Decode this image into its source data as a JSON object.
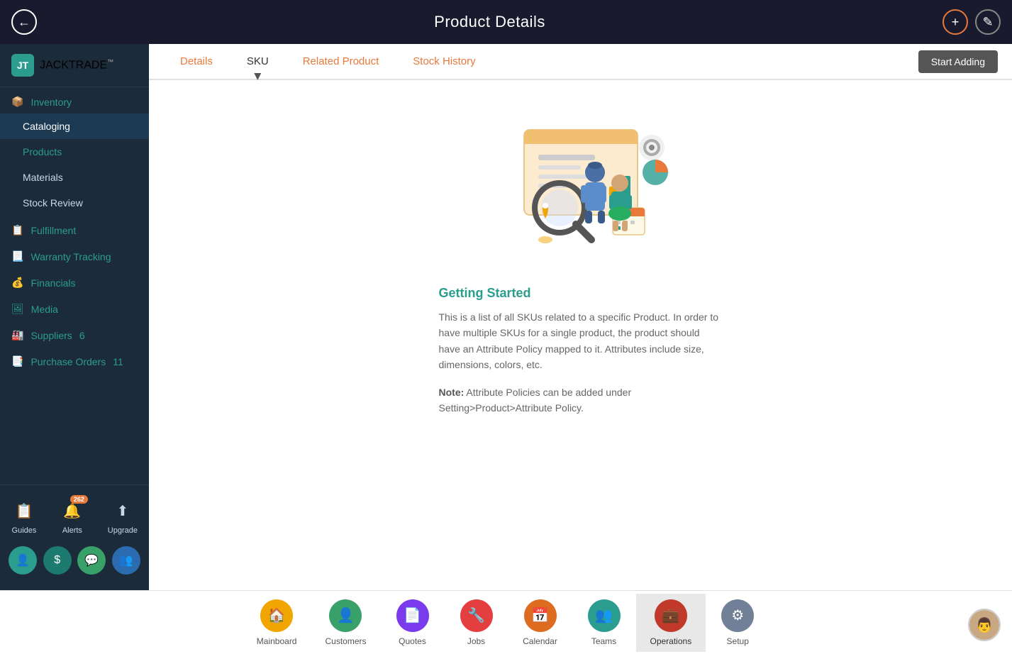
{
  "header": {
    "title": "Product Details",
    "back_label": "←",
    "add_icon": "+",
    "edit_icon": "✎"
  },
  "sidebar": {
    "logo_text": "JACKTRADE",
    "logo_tm": "™",
    "sections": [
      {
        "id": "inventory",
        "label": "Inventory",
        "active": true
      }
    ],
    "items": [
      {
        "id": "cataloging",
        "label": "Cataloging",
        "indent": true,
        "selected": true
      },
      {
        "id": "products",
        "label": "Products",
        "active": true
      },
      {
        "id": "materials",
        "label": "Materials",
        "indent": true
      },
      {
        "id": "stock-review",
        "label": "Stock Review",
        "indent": true
      },
      {
        "id": "fulfillment",
        "label": "Fulfillment"
      },
      {
        "id": "warranty-tracking",
        "label": "Warranty Tracking"
      },
      {
        "id": "financials",
        "label": "Financials"
      },
      {
        "id": "media",
        "label": "Media"
      },
      {
        "id": "suppliers",
        "label": "Suppliers",
        "badge": "6"
      },
      {
        "id": "purchase-orders",
        "label": "Purchase Orders",
        "badge": "11"
      }
    ],
    "bottom_items": [
      {
        "id": "guides",
        "label": "Guides",
        "icon": "📋"
      },
      {
        "id": "alerts",
        "label": "Alerts",
        "icon": "🔔",
        "badge": "262"
      },
      {
        "id": "upgrade",
        "label": "Upgrade",
        "icon": "⬆"
      }
    ],
    "user_icons": [
      {
        "id": "user",
        "icon": "👤",
        "color": "teal"
      },
      {
        "id": "dollar",
        "icon": "$",
        "color": "dark-teal"
      },
      {
        "id": "chat",
        "icon": "💬",
        "color": "green"
      },
      {
        "id": "people",
        "icon": "👥",
        "color": "blue-green"
      }
    ]
  },
  "tabs": [
    {
      "id": "details",
      "label": "Details",
      "active": false
    },
    {
      "id": "sku",
      "label": "SKU",
      "active": true
    },
    {
      "id": "related-product",
      "label": "Related Product",
      "active": false
    },
    {
      "id": "stock-history",
      "label": "Stock History",
      "active": false
    }
  ],
  "start_adding_btn": "Start Adding",
  "content": {
    "getting_started_title": "Getting Started",
    "paragraph1": "This is a list of all SKUs related to a specific Product. In order to have multiple SKUs for a single product, the product should have an Attribute Policy mapped to it. Attributes include size, dimensions, colors, etc.",
    "note_label": "Note:",
    "note_text": " Attribute Policies can be added under Setting>Product>Attribute Policy."
  },
  "bottom_nav": [
    {
      "id": "mainboard",
      "label": "Mainboard",
      "icon": "🏠",
      "color": "yellow"
    },
    {
      "id": "customers",
      "label": "Customers",
      "icon": "👤",
      "color": "green"
    },
    {
      "id": "quotes",
      "label": "Quotes",
      "icon": "📄",
      "color": "purple"
    },
    {
      "id": "jobs",
      "label": "Jobs",
      "icon": "🔧",
      "color": "red"
    },
    {
      "id": "calendar",
      "label": "Calendar",
      "icon": "📅",
      "color": "orange"
    },
    {
      "id": "teams",
      "label": "Teams",
      "icon": "👥",
      "color": "teal"
    },
    {
      "id": "operations",
      "label": "Operations",
      "icon": "💼",
      "color": "dark-red",
      "active": true
    },
    {
      "id": "setup",
      "label": "Setup",
      "icon": "⚙",
      "color": "gray"
    }
  ]
}
